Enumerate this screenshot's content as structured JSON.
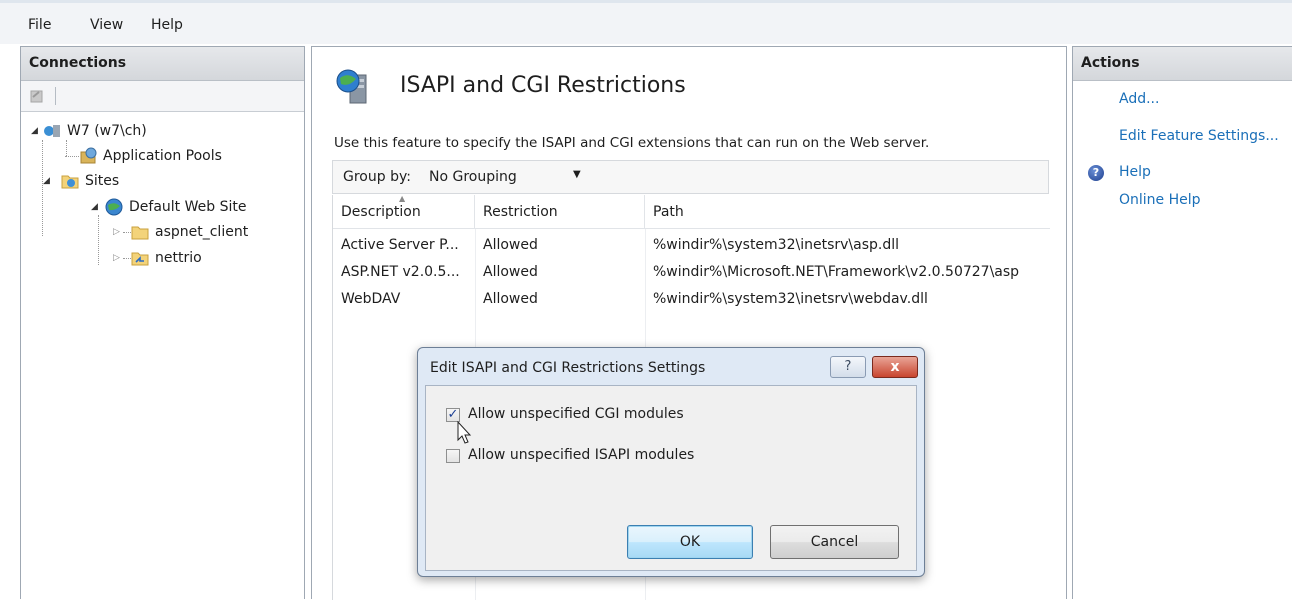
{
  "menu": {
    "items": [
      "File",
      "View",
      "Help"
    ]
  },
  "connections": {
    "header": "Connections",
    "tree": {
      "server": "W7 (w7\\ch)",
      "app_pools": "Application Pools",
      "sites": "Sites",
      "default_site": "Default Web Site",
      "aspnet_client": "aspnet_client",
      "nettrio": "nettrio"
    }
  },
  "feature": {
    "title": "ISAPI and CGI Restrictions",
    "description": "Use this feature to specify the ISAPI and CGI extensions that can run on the Web server.",
    "group_by_label": "Group by:",
    "group_by_value": "No Grouping",
    "columns": [
      "Description",
      "Restriction",
      "Path"
    ],
    "rows": [
      {
        "description": "Active Server P...",
        "restriction": "Allowed",
        "path": "%windir%\\system32\\inetsrv\\asp.dll"
      },
      {
        "description": "ASP.NET v2.0.5...",
        "restriction": "Allowed",
        "path": "%windir%\\Microsoft.NET\\Framework\\v2.0.50727\\asp"
      },
      {
        "description": "WebDAV",
        "restriction": "Allowed",
        "path": "%windir%\\system32\\inetsrv\\webdav.dll"
      }
    ]
  },
  "actions": {
    "header": "Actions",
    "add": "Add...",
    "edit_feature_settings": "Edit Feature Settings...",
    "help": "Help",
    "online_help": "Online Help"
  },
  "dialog": {
    "title": "Edit ISAPI and CGI Restrictions Settings",
    "help_button": "?",
    "close_button": "x",
    "allow_cgi_label": "Allow unspecified CGI modules",
    "allow_cgi_checked": true,
    "allow_isapi_label": "Allow unspecified ISAPI modules",
    "allow_isapi_checked": false,
    "ok": "OK",
    "cancel": "Cancel"
  },
  "colors": {
    "link": "#1a6fb8",
    "dialog_frame": "#dfe9f5",
    "close_red": "#c8452f"
  }
}
